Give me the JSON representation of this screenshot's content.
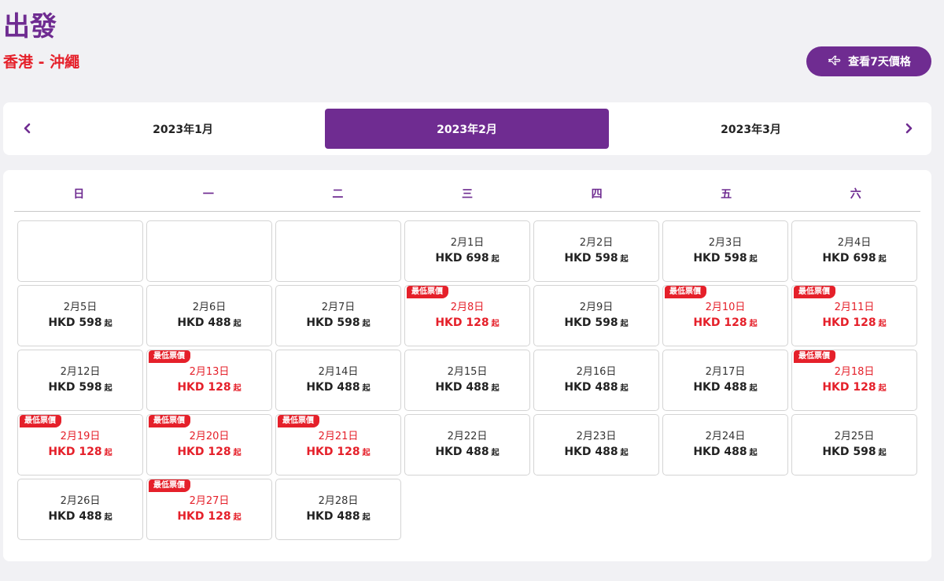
{
  "header": {
    "title": "出發",
    "route": "香港 - 沖繩",
    "week_button_label": "查看7天價格"
  },
  "months": {
    "prev": "2023年1月",
    "current": "2023年2月",
    "next": "2023年3月"
  },
  "weekdays": [
    "日",
    "一",
    "二",
    "三",
    "四",
    "五",
    "六"
  ],
  "calendar": {
    "leading_empty": 3,
    "low_badge_label": "最低票價",
    "price_suffix": "起",
    "days": [
      {
        "date": "2月1日",
        "price": "HKD 698",
        "low": false
      },
      {
        "date": "2月2日",
        "price": "HKD 598",
        "low": false
      },
      {
        "date": "2月3日",
        "price": "HKD 598",
        "low": false
      },
      {
        "date": "2月4日",
        "price": "HKD 698",
        "low": false
      },
      {
        "date": "2月5日",
        "price": "HKD 598",
        "low": false
      },
      {
        "date": "2月6日",
        "price": "HKD 488",
        "low": false
      },
      {
        "date": "2月7日",
        "price": "HKD 598",
        "low": false
      },
      {
        "date": "2月8日",
        "price": "HKD 128",
        "low": true
      },
      {
        "date": "2月9日",
        "price": "HKD 598",
        "low": false
      },
      {
        "date": "2月10日",
        "price": "HKD 128",
        "low": true
      },
      {
        "date": "2月11日",
        "price": "HKD 128",
        "low": true
      },
      {
        "date": "2月12日",
        "price": "HKD 598",
        "low": false
      },
      {
        "date": "2月13日",
        "price": "HKD 128",
        "low": true
      },
      {
        "date": "2月14日",
        "price": "HKD 488",
        "low": false
      },
      {
        "date": "2月15日",
        "price": "HKD 488",
        "low": false
      },
      {
        "date": "2月16日",
        "price": "HKD 488",
        "low": false
      },
      {
        "date": "2月17日",
        "price": "HKD 488",
        "low": false
      },
      {
        "date": "2月18日",
        "price": "HKD 128",
        "low": true
      },
      {
        "date": "2月19日",
        "price": "HKD 128",
        "low": true
      },
      {
        "date": "2月20日",
        "price": "HKD 128",
        "low": true
      },
      {
        "date": "2月21日",
        "price": "HKD 128",
        "low": true
      },
      {
        "date": "2月22日",
        "price": "HKD 488",
        "low": false
      },
      {
        "date": "2月23日",
        "price": "HKD 488",
        "low": false
      },
      {
        "date": "2月24日",
        "price": "HKD 488",
        "low": false
      },
      {
        "date": "2月25日",
        "price": "HKD 598",
        "low": false
      },
      {
        "date": "2月26日",
        "price": "HKD 488",
        "low": false
      },
      {
        "date": "2月27日",
        "price": "HKD 128",
        "low": true
      },
      {
        "date": "2月28日",
        "price": "HKD 488",
        "low": false
      }
    ]
  },
  "colors": {
    "brand_purple": "#6f2c91",
    "low_price_red": "#e5202a"
  },
  "icons": {
    "week_button": "plane-icon",
    "prev": "chevron-left-icon",
    "next": "chevron-right-icon"
  }
}
